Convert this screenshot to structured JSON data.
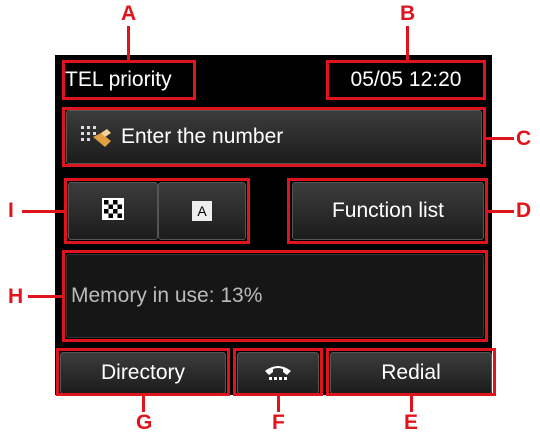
{
  "status_bar": {
    "mode": "TEL priority",
    "datetime": "05/05 12:20"
  },
  "number_field": {
    "label": "Enter the number",
    "icon": "keypad-hand-icon"
  },
  "quality_buttons": {
    "left_icon": "checkered-icon",
    "right_icon": "letter-a-icon",
    "right_glyph": "A"
  },
  "function_button": {
    "label": "Function list"
  },
  "memory": {
    "text": "Memory in use: 13%"
  },
  "bottom_bar": {
    "directory": "Directory",
    "hook_icon": "phone-hook-icon",
    "redial": "Redial"
  },
  "callouts": {
    "a": "A",
    "b": "B",
    "c": "C",
    "d": "D",
    "e": "E",
    "f": "F",
    "g": "G",
    "h": "H",
    "i": "I"
  },
  "colors": {
    "callout_red": "#e0141c",
    "screen_bg": "#000000"
  }
}
